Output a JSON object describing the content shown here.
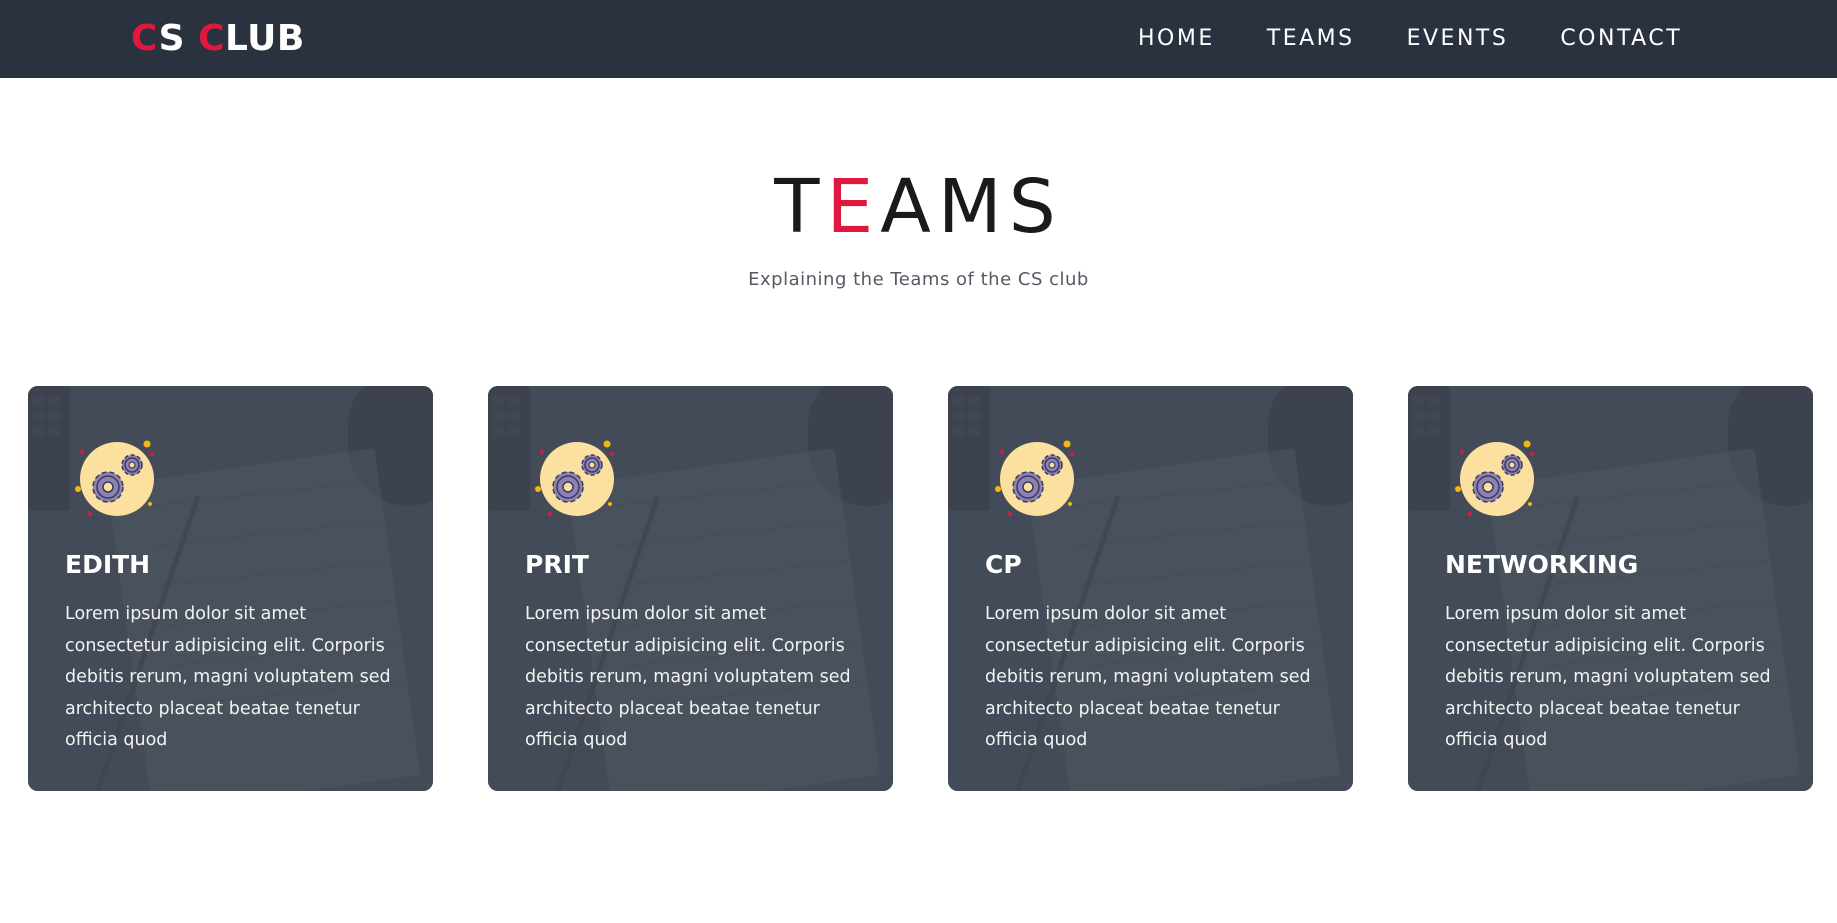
{
  "navbar": {
    "logo": {
      "part1_accent": "C",
      "part1_rest": "S ",
      "part2_accent": "C",
      "part2_rest": "LUB"
    },
    "links": [
      {
        "label": "HOME"
      },
      {
        "label": "TEAMS"
      },
      {
        "label": "EVENTS"
      },
      {
        "label": "CONTACT"
      }
    ]
  },
  "section": {
    "title_start": "T",
    "title_accent": "E",
    "title_end": "AMS",
    "subtitle": "Explaining the Teams of the CS club"
  },
  "cards": [
    {
      "title": "EDITH",
      "text": "Lorem ipsum dolor sit amet consectetur adipisicing elit. Corporis debitis rerum, magni voluptatem sed architecto placeat beatae tenetur officia quod",
      "icon": "gears-icon"
    },
    {
      "title": "PRIT",
      "text": "Lorem ipsum dolor sit amet consectetur adipisicing elit. Corporis debitis rerum, magni voluptatem sed architecto placeat beatae tenetur officia quod",
      "icon": "gears-icon"
    },
    {
      "title": "CP",
      "text": "Lorem ipsum dolor sit amet consectetur adipisicing elit. Corporis debitis rerum, magni voluptatem sed architecto placeat beatae tenetur officia quod",
      "icon": "gears-icon"
    },
    {
      "title": "NETWORKING",
      "text": "Lorem ipsum dolor sit amet consectetur adipisicing elit. Corporis debitis rerum, magni voluptatem sed architecto placeat beatae tenetur officia quod",
      "icon": "gears-icon"
    }
  ],
  "colors": {
    "navbar_bg": "#2b323f",
    "accent": "#e0183f",
    "card_bg": "#454c57",
    "icon_circle": "#fbe0a0",
    "gear": "#8c82b4"
  }
}
